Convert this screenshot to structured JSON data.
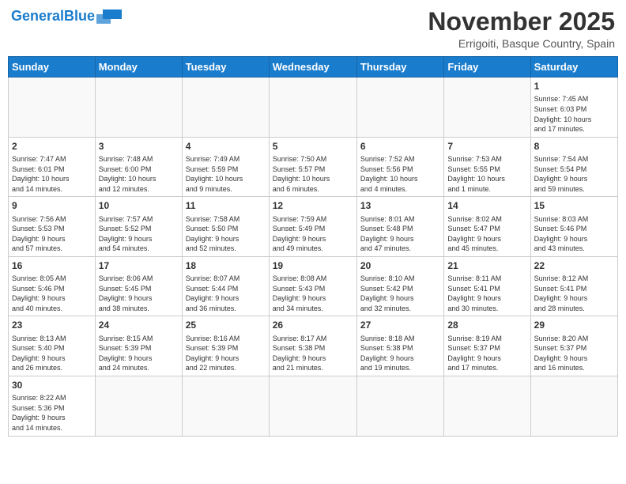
{
  "header": {
    "logo_general": "General",
    "logo_blue": "Blue",
    "month_title": "November 2025",
    "location": "Errigoiti, Basque Country, Spain"
  },
  "weekdays": [
    "Sunday",
    "Monday",
    "Tuesday",
    "Wednesday",
    "Thursday",
    "Friday",
    "Saturday"
  ],
  "weeks": [
    [
      {
        "day": "",
        "info": ""
      },
      {
        "day": "",
        "info": ""
      },
      {
        "day": "",
        "info": ""
      },
      {
        "day": "",
        "info": ""
      },
      {
        "day": "",
        "info": ""
      },
      {
        "day": "",
        "info": ""
      },
      {
        "day": "1",
        "info": "Sunrise: 7:45 AM\nSunset: 6:03 PM\nDaylight: 10 hours\nand 17 minutes."
      }
    ],
    [
      {
        "day": "2",
        "info": "Sunrise: 7:47 AM\nSunset: 6:01 PM\nDaylight: 10 hours\nand 14 minutes."
      },
      {
        "day": "3",
        "info": "Sunrise: 7:48 AM\nSunset: 6:00 PM\nDaylight: 10 hours\nand 12 minutes."
      },
      {
        "day": "4",
        "info": "Sunrise: 7:49 AM\nSunset: 5:59 PM\nDaylight: 10 hours\nand 9 minutes."
      },
      {
        "day": "5",
        "info": "Sunrise: 7:50 AM\nSunset: 5:57 PM\nDaylight: 10 hours\nand 6 minutes."
      },
      {
        "day": "6",
        "info": "Sunrise: 7:52 AM\nSunset: 5:56 PM\nDaylight: 10 hours\nand 4 minutes."
      },
      {
        "day": "7",
        "info": "Sunrise: 7:53 AM\nSunset: 5:55 PM\nDaylight: 10 hours\nand 1 minute."
      },
      {
        "day": "8",
        "info": "Sunrise: 7:54 AM\nSunset: 5:54 PM\nDaylight: 9 hours\nand 59 minutes."
      }
    ],
    [
      {
        "day": "9",
        "info": "Sunrise: 7:56 AM\nSunset: 5:53 PM\nDaylight: 9 hours\nand 57 minutes."
      },
      {
        "day": "10",
        "info": "Sunrise: 7:57 AM\nSunset: 5:52 PM\nDaylight: 9 hours\nand 54 minutes."
      },
      {
        "day": "11",
        "info": "Sunrise: 7:58 AM\nSunset: 5:50 PM\nDaylight: 9 hours\nand 52 minutes."
      },
      {
        "day": "12",
        "info": "Sunrise: 7:59 AM\nSunset: 5:49 PM\nDaylight: 9 hours\nand 49 minutes."
      },
      {
        "day": "13",
        "info": "Sunrise: 8:01 AM\nSunset: 5:48 PM\nDaylight: 9 hours\nand 47 minutes."
      },
      {
        "day": "14",
        "info": "Sunrise: 8:02 AM\nSunset: 5:47 PM\nDaylight: 9 hours\nand 45 minutes."
      },
      {
        "day": "15",
        "info": "Sunrise: 8:03 AM\nSunset: 5:46 PM\nDaylight: 9 hours\nand 43 minutes."
      }
    ],
    [
      {
        "day": "16",
        "info": "Sunrise: 8:05 AM\nSunset: 5:46 PM\nDaylight: 9 hours\nand 40 minutes."
      },
      {
        "day": "17",
        "info": "Sunrise: 8:06 AM\nSunset: 5:45 PM\nDaylight: 9 hours\nand 38 minutes."
      },
      {
        "day": "18",
        "info": "Sunrise: 8:07 AM\nSunset: 5:44 PM\nDaylight: 9 hours\nand 36 minutes."
      },
      {
        "day": "19",
        "info": "Sunrise: 8:08 AM\nSunset: 5:43 PM\nDaylight: 9 hours\nand 34 minutes."
      },
      {
        "day": "20",
        "info": "Sunrise: 8:10 AM\nSunset: 5:42 PM\nDaylight: 9 hours\nand 32 minutes."
      },
      {
        "day": "21",
        "info": "Sunrise: 8:11 AM\nSunset: 5:41 PM\nDaylight: 9 hours\nand 30 minutes."
      },
      {
        "day": "22",
        "info": "Sunrise: 8:12 AM\nSunset: 5:41 PM\nDaylight: 9 hours\nand 28 minutes."
      }
    ],
    [
      {
        "day": "23",
        "info": "Sunrise: 8:13 AM\nSunset: 5:40 PM\nDaylight: 9 hours\nand 26 minutes."
      },
      {
        "day": "24",
        "info": "Sunrise: 8:15 AM\nSunset: 5:39 PM\nDaylight: 9 hours\nand 24 minutes."
      },
      {
        "day": "25",
        "info": "Sunrise: 8:16 AM\nSunset: 5:39 PM\nDaylight: 9 hours\nand 22 minutes."
      },
      {
        "day": "26",
        "info": "Sunrise: 8:17 AM\nSunset: 5:38 PM\nDaylight: 9 hours\nand 21 minutes."
      },
      {
        "day": "27",
        "info": "Sunrise: 8:18 AM\nSunset: 5:38 PM\nDaylight: 9 hours\nand 19 minutes."
      },
      {
        "day": "28",
        "info": "Sunrise: 8:19 AM\nSunset: 5:37 PM\nDaylight: 9 hours\nand 17 minutes."
      },
      {
        "day": "29",
        "info": "Sunrise: 8:20 AM\nSunset: 5:37 PM\nDaylight: 9 hours\nand 16 minutes."
      }
    ],
    [
      {
        "day": "30",
        "info": "Sunrise: 8:22 AM\nSunset: 5:36 PM\nDaylight: 9 hours\nand 14 minutes."
      },
      {
        "day": "",
        "info": ""
      },
      {
        "day": "",
        "info": ""
      },
      {
        "day": "",
        "info": ""
      },
      {
        "day": "",
        "info": ""
      },
      {
        "day": "",
        "info": ""
      },
      {
        "day": "",
        "info": ""
      }
    ]
  ]
}
